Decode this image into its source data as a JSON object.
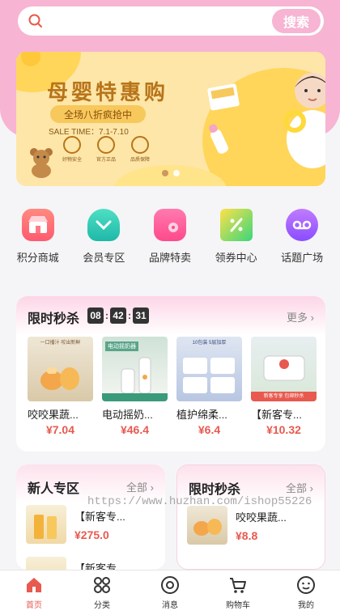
{
  "search": {
    "placeholder": "",
    "button_label": "搜索"
  },
  "banner": {
    "title": "母婴特惠购",
    "tag": "全场八折疯抢中",
    "time": "SALE TIME：7.1-7.10",
    "icons": [
      {
        "name": "feature-icon-1",
        "label": "好物安全"
      },
      {
        "name": "feature-icon-2",
        "label": "官方正品"
      },
      {
        "name": "feature-icon-3",
        "label": "品质保障"
      }
    ],
    "page_count": 2,
    "active_page": 1
  },
  "nav": [
    {
      "label": "积分商城",
      "icon": "shop-icon"
    },
    {
      "label": "会员专区",
      "icon": "vip-heart-icon"
    },
    {
      "label": "品牌特卖",
      "icon": "brand-tag-icon"
    },
    {
      "label": "领券中心",
      "icon": "coupon-icon"
    },
    {
      "label": "话题广场",
      "icon": "topic-voicemail-icon"
    }
  ],
  "flash_sale": {
    "title": "限时秒杀",
    "timer": {
      "h": "08",
      "m": "42",
      "s": "31"
    },
    "more_label": "更多",
    "products": [
      {
        "name": "咬咬果蔬...",
        "price": "¥7.04",
        "img_caption": "一口播汁 咬出新鲜"
      },
      {
        "name": "电动摇奶...",
        "price": "¥46.4",
        "img_caption": "电动摇奶器"
      },
      {
        "name": "植护绵柔...",
        "price": "¥6.4",
        "img_caption": "10包装 5层加厚"
      },
      {
        "name": "【新客专...",
        "price": "¥10.32",
        "img_caption": "新客专享 包邮秒杀"
      }
    ]
  },
  "new_user": {
    "title": "新人专区",
    "more_label": "全部",
    "items": [
      {
        "name": "【新客专...",
        "price": "¥275.0"
      },
      {
        "name": "【新客专...",
        "price": ""
      }
    ]
  },
  "flash_sale_mini": {
    "title": "限时秒杀",
    "more_label": "全部",
    "items": [
      {
        "name": "咬咬果蔬...",
        "price": "¥8.8"
      }
    ]
  },
  "watermark": "https://www.huzhan.com/ishop55226",
  "tabbar": [
    {
      "label": "首页",
      "icon": "home-icon",
      "active": true
    },
    {
      "label": "分类",
      "icon": "category-icon",
      "active": false
    },
    {
      "label": "消息",
      "icon": "message-icon",
      "active": false
    },
    {
      "label": "购物车",
      "icon": "cart-icon",
      "active": false
    },
    {
      "label": "我的",
      "icon": "profile-icon",
      "active": false
    }
  ],
  "colors": {
    "brand_pink": "#f7b4d3",
    "price_red": "#e8594f",
    "active_tab": "#e8594f"
  }
}
